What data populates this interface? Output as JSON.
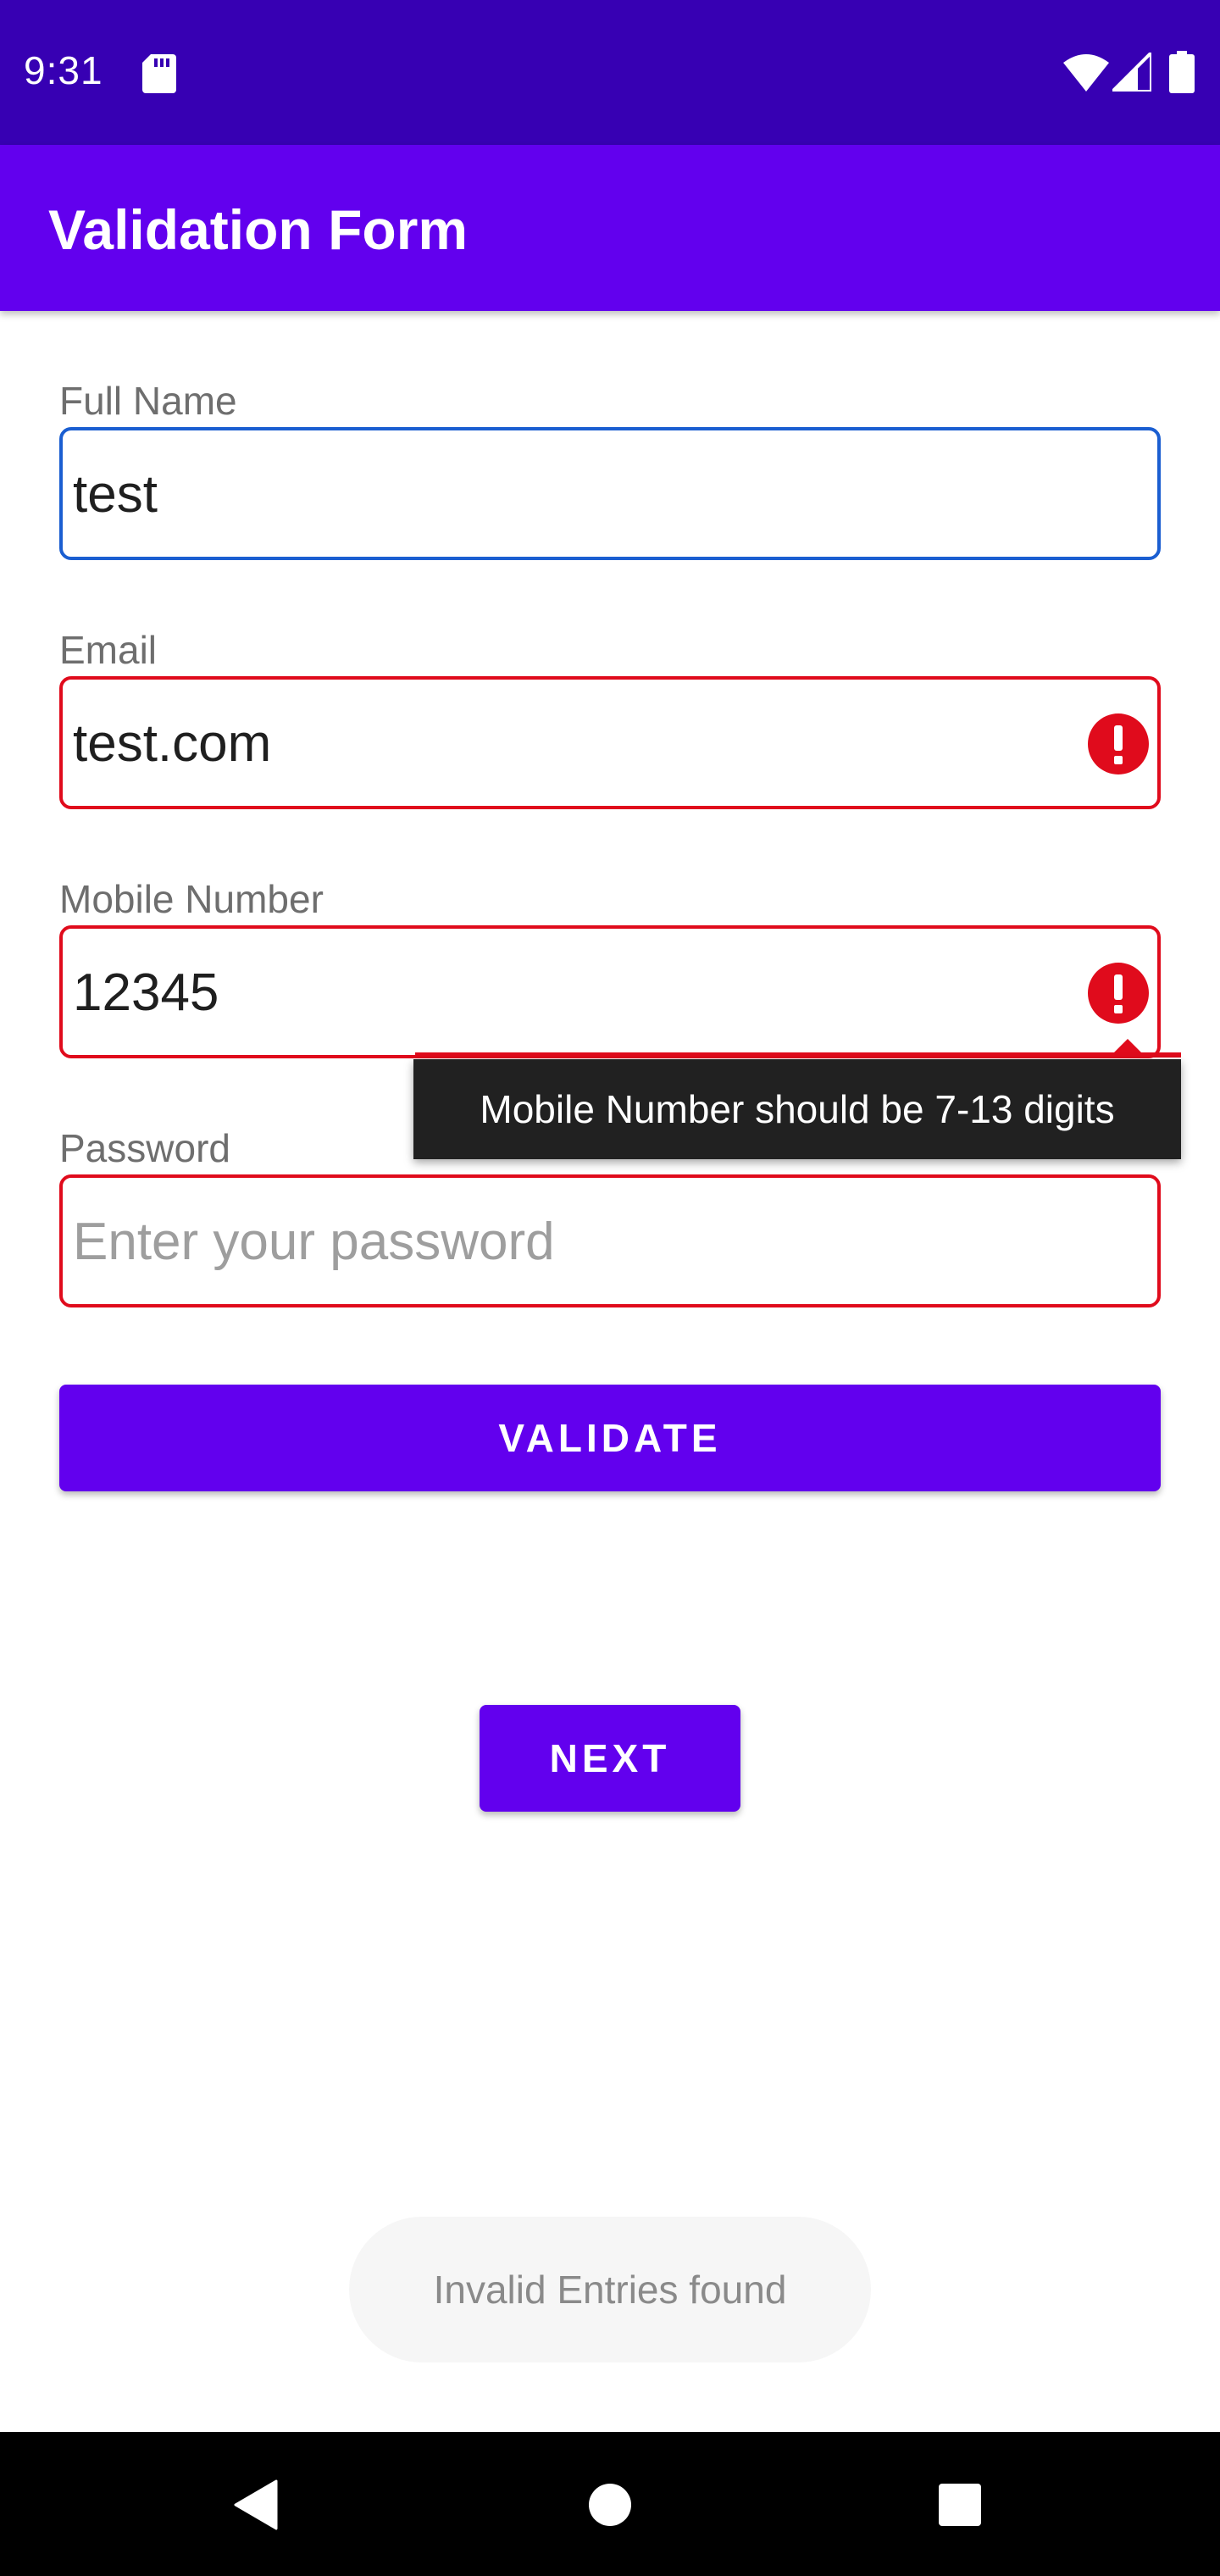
{
  "status_bar": {
    "time": "9:31",
    "icons": [
      "sd-card-icon",
      "wifi-icon",
      "signal-icon",
      "battery-icon"
    ]
  },
  "app_bar": {
    "title": "Validation Form"
  },
  "form": {
    "full_name": {
      "label": "Full Name",
      "value": "test",
      "state": "focused"
    },
    "email": {
      "label": "Email",
      "value": "test.com",
      "state": "error"
    },
    "mobile": {
      "label": "Mobile Number",
      "value": "12345",
      "state": "error",
      "error_message": "Mobile Number should be 7-13 digits"
    },
    "password": {
      "label": "Password",
      "value": "",
      "placeholder": "Enter your password",
      "state": "error"
    }
  },
  "buttons": {
    "validate": "VALIDATE",
    "next": "NEXT"
  },
  "toast": {
    "message": "Invalid Entries found"
  },
  "nav_bar": {
    "icons": [
      "back-icon",
      "home-icon",
      "recents-icon"
    ]
  },
  "colors": {
    "status_bar": "#3700b3",
    "primary": "#6200ee",
    "error": "#e00b1c",
    "focus": "#1a5ed1",
    "tooltip_bg": "#212121"
  }
}
